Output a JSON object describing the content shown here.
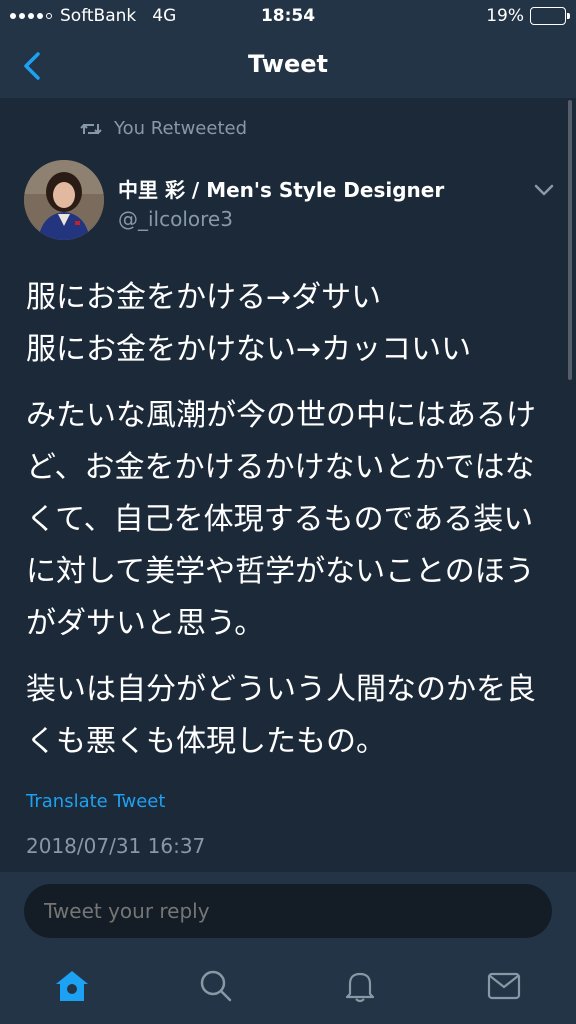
{
  "status_bar": {
    "carrier": "SoftBank",
    "network": "4G",
    "time": "18:54",
    "battery": "19%",
    "battery_level": 0.19,
    "battery_color": "#ff3b30"
  },
  "header": {
    "title": "Tweet",
    "back_icon": "chevron-left-icon"
  },
  "tweet": {
    "retweet_context": "You Retweeted",
    "author_name": "中里 彩 / Men's Style Designer",
    "author_handle": "@_ilcolore3",
    "paragraphs": [
      "服にお金をかける→ダサい\n服にお金をかけない→カッコいい",
      "みたいな風潮が今の世の中にはあるけど、お金をかけるかけないとかではなくて、自己を体現するものである装いに対して美学や哲学がないことのほうがダサいと思う。",
      "装いは自分がどういう人間なのかを良くも悪くも体現したもの。"
    ],
    "translate_label": "Translate Tweet",
    "timestamp": "2018/07/31 16:37"
  },
  "reply": {
    "placeholder": "Tweet your reply"
  },
  "tabbar": {
    "items": [
      {
        "icon": "home-icon",
        "active": true
      },
      {
        "icon": "search-icon",
        "active": false
      },
      {
        "icon": "bell-icon",
        "active": false
      },
      {
        "icon": "mail-icon",
        "active": false
      }
    ]
  },
  "colors": {
    "accent": "#1da1f2",
    "background": "#1c2938",
    "bar": "#243447",
    "muted_text": "#8899a6"
  }
}
